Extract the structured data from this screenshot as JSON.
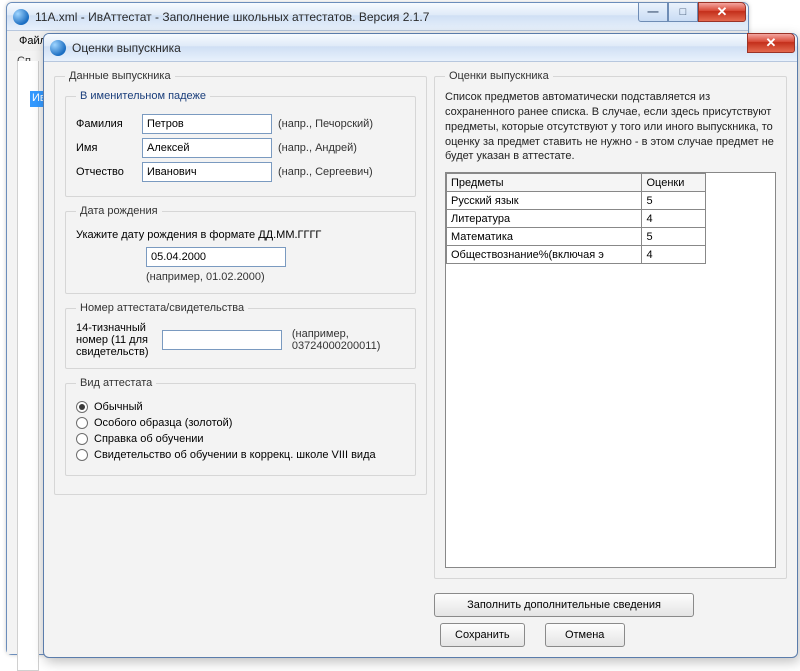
{
  "outer": {
    "title": "11А.xml - ИвАттестат - Заполнение школьных аттестатов. Версия 2.1.7",
    "menu_file": "Файл",
    "tab_stub": "Сп",
    "selected_stub": "Ив"
  },
  "dialog": {
    "title": "Оценки выпускника",
    "left_legend": "Данные выпускника",
    "name_legend": "В именительном падеже",
    "surname_label": "Фамилия",
    "surname_value": "Петров",
    "surname_hint": "(напр., Печорский)",
    "firstname_label": "Имя",
    "firstname_value": "Алексей",
    "firstname_hint": "(напр., Андрей)",
    "patronymic_label": "Отчество",
    "patronymic_value": "Иванович",
    "patronymic_hint": "(напр., Сергеевич)",
    "dob_legend": "Дата рождения",
    "dob_hint": "Укажите дату рождения в формате ДД.ММ.ГГГГ",
    "dob_value": "05.04.2000",
    "dob_example": "(например, 01.02.2000)",
    "cert_legend": "Номер аттестата/свидетельства",
    "cert_label": "14-тизначный номер (11 для свидетельств)",
    "cert_value": "",
    "cert_hint": "(например, 03724000200011)",
    "type_legend": "Вид аттестата",
    "type_options": [
      "Обычный",
      "Особого образца (золотой)",
      "Справка об обучении",
      "Свидетельство об обучении в коррекц. школе VIII вида"
    ],
    "type_selected_index": 0,
    "right_legend": "Оценки выпускника",
    "right_info": "Список предметов автоматически подставляется из сохраненного ранее списка. В случае, если здесь присутствуют предметы, которые отсутствуют у того или иного выпускника, то оценку за предмет ставить не нужно - в этом случае предмет не будет указан в аттестате.",
    "col_subject": "Предметы",
    "col_score": "Оценки",
    "grades": [
      {
        "subject": "Русский язык",
        "score": "5"
      },
      {
        "subject": "Литература",
        "score": "4"
      },
      {
        "subject": "Математика",
        "score": "5"
      },
      {
        "subject": "Обществознание%(включая э",
        "score": "4"
      }
    ],
    "btn_additional": "Заполнить дополнительные сведения",
    "btn_save": "Сохранить",
    "btn_cancel": "Отмена"
  }
}
